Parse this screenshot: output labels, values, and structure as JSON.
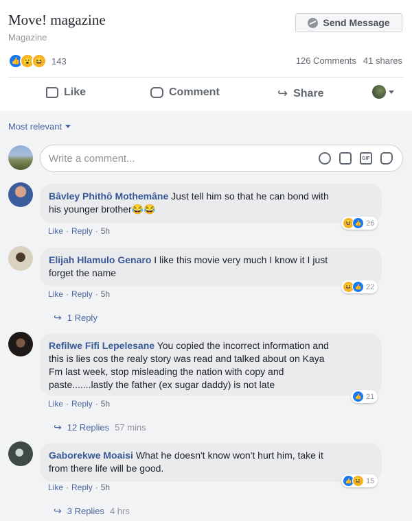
{
  "post": {
    "page_name": "Move! magazine",
    "category": "Magazine",
    "send_message_label": "Send Message",
    "reaction_icons": [
      "like-icon",
      "wow-icon",
      "haha-icon"
    ],
    "reaction_count": "143",
    "comments_count": "126 Comments",
    "shares_count": "41 shares"
  },
  "actions": {
    "like_label": "Like",
    "comment_label": "Comment",
    "share_label": "Share"
  },
  "filter": {
    "label": "Most relevant"
  },
  "composer": {
    "placeholder": "Write a comment..."
  },
  "comments": [
    {
      "author": "Bâvley Phithô Mothemâne",
      "text_line1": "Just tell him so that he can bond with",
      "text_line2": "his younger brother😂😂",
      "like_label": "Like",
      "reply_label": "Reply",
      "time": "5h",
      "reaction_icons": [
        "haha-icon",
        "like-icon"
      ],
      "reactions": "26"
    },
    {
      "author": "Elijah Hlamulo Genaro",
      "text_line1": "I like this movie very much I know it I just",
      "text_line2": "forget the name",
      "like_label": "Like",
      "reply_label": "Reply",
      "time": "5h",
      "reaction_icons": [
        "haha-icon",
        "like-icon"
      ],
      "reactions": "22",
      "replies": "1 Reply"
    },
    {
      "author": "Refilwe Fifi Lepelesane",
      "text_line1": "You copied the incorrect information and",
      "text_line2": "this is lies cos the realy story was read and talked about on Kaya",
      "text_line3": "Fm last week, stop misleading the nation with copy and",
      "text_line4": "paste.......lastly the father (ex sugar daddy) is not late",
      "like_label": "Like",
      "reply_label": "Reply",
      "time": "5h",
      "reaction_icons": [
        "like-icon"
      ],
      "reactions": "21",
      "replies": "12 Replies",
      "replies_time": "57 mins"
    },
    {
      "author": "Gaborekwe Moaisi",
      "text_line1": "What he doesn't know won't hurt him, take it",
      "text_line2": "from there life will be good.",
      "like_label": "Like",
      "reply_label": "Reply",
      "time": "5h",
      "reaction_icons": [
        "like-icon",
        "haha-icon"
      ],
      "reactions": "15",
      "replies": "3 Replies",
      "replies_time": "4 hrs"
    }
  ],
  "colors": {
    "link": "#385898",
    "like_blue": "#1877f2",
    "bubble": "#eaebed",
    "haha_yellow": "#f7b125"
  }
}
